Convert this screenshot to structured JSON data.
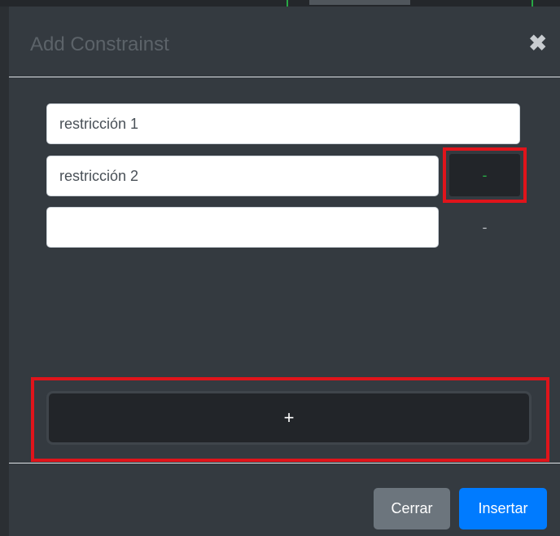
{
  "modal": {
    "title": "Add Constrainst",
    "close_icon": "close-icon",
    "close_glyph": "✖"
  },
  "constraints": [
    {
      "value": "restricción 1",
      "placeholder": ""
    },
    {
      "value": "restricción 2",
      "placeholder": "",
      "remove_label": "-"
    },
    {
      "value": "",
      "placeholder": "",
      "remove_label": "-"
    }
  ],
  "add_button": {
    "label": "+"
  },
  "footer": {
    "close_label": "Cerrar",
    "insert_label": "Insertar"
  },
  "colors": {
    "background": "#343a40",
    "close_button": "#6c757d",
    "insert_button": "#007bff",
    "highlight": "#e0141b",
    "remove_glyph": "#28a745"
  }
}
